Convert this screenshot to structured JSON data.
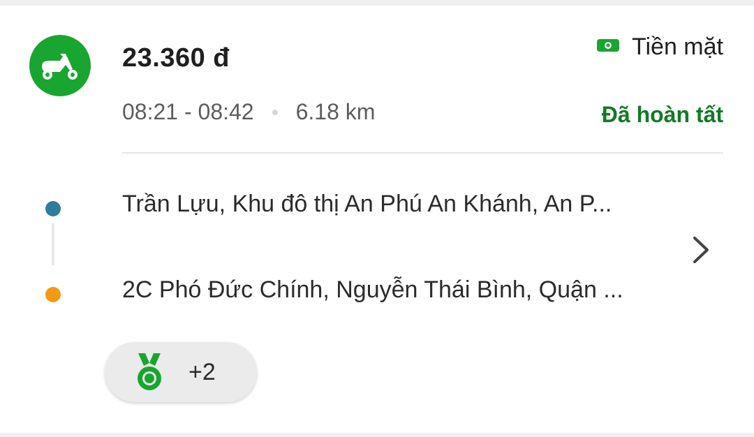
{
  "trip": {
    "service_icon": "motorbike-icon",
    "price": "23.360 đ",
    "payment": {
      "icon": "cash-icon",
      "label": "Tiền mặt"
    },
    "time_range": "08:21 - 08:42",
    "distance": "6.18 km",
    "status": "Đã hoàn tất",
    "pickup_address": "Trần Lựu, Khu đô thị An Phú An Khánh, An P...",
    "dropoff_address": "2C Phó Đức Chính, Nguyễn Thái Bình, Quận ...",
    "reward_badge": {
      "icon": "medal-icon",
      "count": "+2"
    },
    "details_icon": "chevron-right-icon"
  },
  "colors": {
    "brand_green": "#18a530",
    "status_green": "#137a26",
    "pickup_dot": "#2e7d9a",
    "dropoff_dot": "#f39a13"
  }
}
